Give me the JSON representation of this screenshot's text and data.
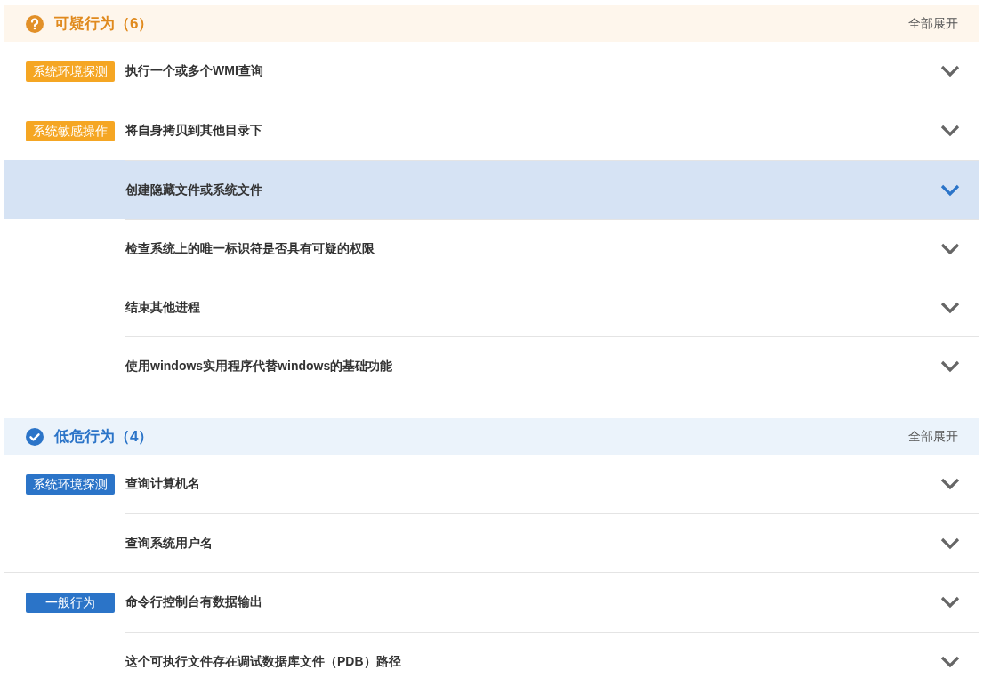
{
  "sections": [
    {
      "kind": "suspicious",
      "title": "可疑行为",
      "count": "（6）",
      "expand_all": "全部展开",
      "groups": [
        {
          "tag": "系统环境探测",
          "items": [
            {
              "text": "执行一个或多个WMI查询",
              "selected": false
            }
          ]
        },
        {
          "tag": "系统敏感操作",
          "items": [
            {
              "text": "将自身拷贝到其他目录下",
              "selected": false
            },
            {
              "text": "创建隐藏文件或系统文件",
              "selected": true
            },
            {
              "text": "检查系统上的唯一标识符是否具有可疑的权限",
              "selected": false
            },
            {
              "text": "结束其他进程",
              "selected": false
            },
            {
              "text": "使用windows实用程序代替windows的基础功能",
              "selected": false
            }
          ]
        }
      ]
    },
    {
      "kind": "low",
      "title": "低危行为",
      "count": "（4）",
      "expand_all": "全部展开",
      "groups": [
        {
          "tag": "系统环境探测",
          "items": [
            {
              "text": "查询计算机名",
              "selected": false
            },
            {
              "text": "查询系统用户名",
              "selected": false
            }
          ]
        },
        {
          "tag": "一般行为",
          "items": [
            {
              "text": "命令行控制台有数据输出",
              "selected": false
            },
            {
              "text": "这个可执行文件存在调试数据库文件（PDB）路径",
              "selected": false
            }
          ]
        }
      ]
    }
  ]
}
